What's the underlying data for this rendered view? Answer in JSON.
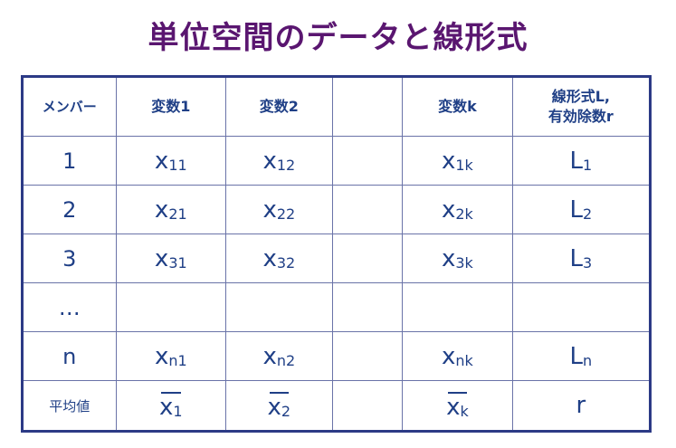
{
  "title": "単位空間のデータと線形式",
  "headers": {
    "member": "メンバー",
    "var1": "変数1",
    "var2": "変数2",
    "gap": "",
    "vark": "変数k",
    "last_line1": "線形式L,",
    "last_line2": "有効除数r"
  },
  "rows": [
    {
      "label": "1",
      "c1": {
        "base": "x",
        "sub": "11"
      },
      "c2": {
        "base": "x",
        "sub": "12"
      },
      "ck": {
        "base": "x",
        "sub": "1k"
      },
      "cl": {
        "base": "L",
        "sub": "1"
      }
    },
    {
      "label": "2",
      "c1": {
        "base": "x",
        "sub": "21"
      },
      "c2": {
        "base": "x",
        "sub": "22"
      },
      "ck": {
        "base": "x",
        "sub": "2k"
      },
      "cl": {
        "base": "L",
        "sub": "2"
      }
    },
    {
      "label": "3",
      "c1": {
        "base": "x",
        "sub": "31"
      },
      "c2": {
        "base": "x",
        "sub": "32"
      },
      "ck": {
        "base": "x",
        "sub": "3k"
      },
      "cl": {
        "base": "L",
        "sub": "3"
      }
    },
    {
      "label": "…",
      "c1": {
        "base": "",
        "sub": ""
      },
      "c2": {
        "base": "",
        "sub": ""
      },
      "ck": {
        "base": "",
        "sub": ""
      },
      "cl": {
        "base": "",
        "sub": ""
      }
    },
    {
      "label": "n",
      "c1": {
        "base": "x",
        "sub": "n1"
      },
      "c2": {
        "base": "x",
        "sub": "n2"
      },
      "ck": {
        "base": "x",
        "sub": "nk"
      },
      "cl": {
        "base": "L",
        "sub": "n"
      }
    }
  ],
  "mean_row": {
    "label": "平均値",
    "c1": {
      "base": "x",
      "sub": "1"
    },
    "c2": {
      "base": "x",
      "sub": "2"
    },
    "ck": {
      "base": "x",
      "sub": "k"
    },
    "cl": "r"
  },
  "colors": {
    "title": "#5a1670",
    "text": "#1f3f86",
    "border": "#2c3a86"
  }
}
